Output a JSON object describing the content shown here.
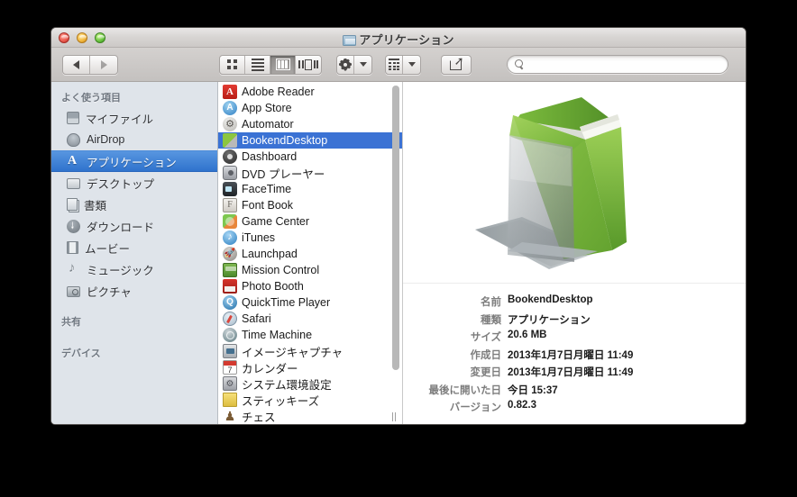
{
  "window": {
    "title": "アプリケーション",
    "title_icon": "folder-icon",
    "controls": {
      "close": "close",
      "minimize": "minimize",
      "zoom": "zoom"
    }
  },
  "toolbar": {
    "back_label": "◀",
    "forward_label": "▶",
    "view_buttons": [
      {
        "name": "icon-view",
        "icon": "grid-icon",
        "selected": false
      },
      {
        "name": "list-view",
        "icon": "list-icon",
        "selected": false
      },
      {
        "name": "column-view",
        "icon": "columns-icon",
        "selected": true
      },
      {
        "name": "coverflow-view",
        "icon": "coverflow-icon",
        "selected": false
      }
    ],
    "action_menu_icon": "gear-icon",
    "arrange_menu_icon": "arrange-icon",
    "share_icon": "share-icon",
    "search": {
      "placeholder": "",
      "value": "",
      "icon": "search-icon"
    }
  },
  "sidebar": {
    "sections": [
      {
        "header": "よく使う項目",
        "items": [
          {
            "label": "マイファイル",
            "icon": "myfiles-icon",
            "selected": false
          },
          {
            "label": "AirDrop",
            "icon": "airdrop-icon",
            "selected": false
          },
          {
            "label": "アプリケーション",
            "icon": "applications-icon",
            "selected": true
          },
          {
            "label": "デスクトップ",
            "icon": "desktop-icon",
            "selected": false
          },
          {
            "label": "書類",
            "icon": "documents-icon",
            "selected": false
          },
          {
            "label": "ダウンロード",
            "icon": "downloads-icon",
            "selected": false
          },
          {
            "label": "ムービー",
            "icon": "movies-icon",
            "selected": false
          },
          {
            "label": "ミュージック",
            "icon": "music-icon",
            "selected": false
          },
          {
            "label": "ピクチャ",
            "icon": "pictures-icon",
            "selected": false
          }
        ]
      },
      {
        "header": "共有",
        "items": []
      },
      {
        "header": "デバイス",
        "items": []
      }
    ]
  },
  "file_list": [
    {
      "name": "Adobe Reader",
      "icon": "adobe-reader-icon",
      "selected": false
    },
    {
      "name": "App Store",
      "icon": "app-store-icon",
      "selected": false
    },
    {
      "name": "Automator",
      "icon": "automator-icon",
      "selected": false
    },
    {
      "name": "BookendDesktop",
      "icon": "bookend-desktop-icon",
      "selected": true
    },
    {
      "name": "Dashboard",
      "icon": "dashboard-icon",
      "selected": false
    },
    {
      "name": "DVD プレーヤー",
      "icon": "dvd-player-icon",
      "selected": false
    },
    {
      "name": "FaceTime",
      "icon": "facetime-icon",
      "selected": false
    },
    {
      "name": "Font Book",
      "icon": "font-book-icon",
      "selected": false
    },
    {
      "name": "Game Center",
      "icon": "game-center-icon",
      "selected": false
    },
    {
      "name": "iTunes",
      "icon": "itunes-icon",
      "selected": false
    },
    {
      "name": "Launchpad",
      "icon": "launchpad-icon",
      "selected": false
    },
    {
      "name": "Mission Control",
      "icon": "mission-control-icon",
      "selected": false
    },
    {
      "name": "Photo Booth",
      "icon": "photo-booth-icon",
      "selected": false
    },
    {
      "name": "QuickTime Player",
      "icon": "quicktime-player-icon",
      "selected": false
    },
    {
      "name": "Safari",
      "icon": "safari-icon",
      "selected": false
    },
    {
      "name": "Time Machine",
      "icon": "time-machine-icon",
      "selected": false
    },
    {
      "name": "イメージキャプチャ",
      "icon": "image-capture-icon",
      "selected": false
    },
    {
      "name": "カレンダー",
      "icon": "calendar-icon",
      "selected": false
    },
    {
      "name": "システム環境設定",
      "icon": "system-preferences-icon",
      "selected": false
    },
    {
      "name": "スティッキーズ",
      "icon": "stickies-icon",
      "selected": false
    },
    {
      "name": "チェス",
      "icon": "chess-icon",
      "selected": false
    }
  ],
  "preview": {
    "icon_name": "bookend-desktop-large-icon",
    "metadata": [
      {
        "label": "名前",
        "value": "BookendDesktop"
      },
      {
        "label": "種類",
        "value": "アプリケーション"
      },
      {
        "label": "サイズ",
        "value": "20.6 MB"
      },
      {
        "label": "作成日",
        "value": "2013年1月7日月曜日 11:49"
      },
      {
        "label": "変更日",
        "value": "2013年1月7日月曜日 11:49"
      },
      {
        "label": "最後に開いた日",
        "value": "今日 15:37"
      },
      {
        "label": "バージョン",
        "value": "0.82.3"
      }
    ]
  },
  "colors": {
    "selection_blue": "#3b72d4",
    "sidebar_selection_blue": "#2f73cd",
    "sidebar_background": "#dfe4ea",
    "toolbar_background": "#c4c1bf",
    "book_green": "#8cc63f",
    "bookend_gray": "#b0b5b8"
  }
}
